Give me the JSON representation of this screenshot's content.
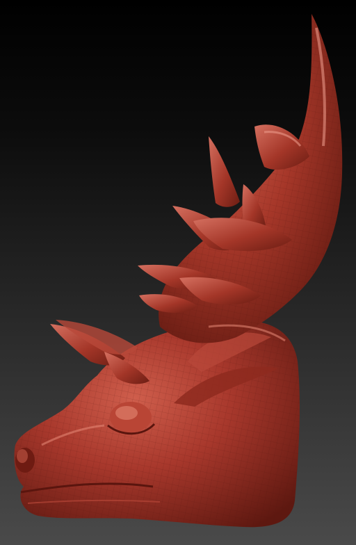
{
  "scene": {
    "subject": "sculpt-model",
    "material_color": "#a8382c",
    "shadow_color": "#5e1810",
    "highlight_color": "#d8705e",
    "background_top": "#000000",
    "background_bottom": "#4a4a4a",
    "wireframe_visible": true
  }
}
